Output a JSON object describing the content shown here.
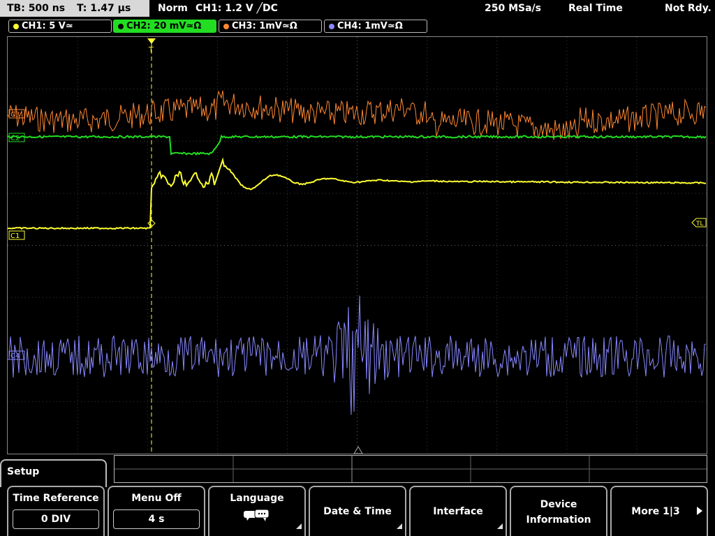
{
  "status": {
    "timebase": "TB: 500 ns",
    "trigger_time": "T: 1.47 µs",
    "trigger_mode": "Norm",
    "trigger_info": "CH1: 1.2 V ╱DC",
    "sample_rate": "250 MSa/s",
    "acq_mode": "Real Time",
    "state": "Not Rdy."
  },
  "channels": [
    {
      "label": "CH1: 5 V≃",
      "color": "#ffff33"
    },
    {
      "label": "CH2: 20 mV≃Ω",
      "color": "#22dd22"
    },
    {
      "label": "CH3: 1mV≃Ω",
      "color": "#ff8833"
    },
    {
      "label": "CH4: 1mV≃Ω",
      "color": "#8888ff"
    }
  ],
  "markers": {
    "c1": "C1",
    "c2": "C2",
    "c3": "C3",
    "c4": "C4",
    "tl": "TL",
    "trigger": "T"
  },
  "menu": {
    "title": "Setup",
    "softkeys": [
      {
        "label": "Time Reference",
        "value": "0 DIV"
      },
      {
        "label": "Menu Off",
        "value": "4 s"
      },
      {
        "label": "Language"
      },
      {
        "label": "Date & Time"
      },
      {
        "label": "Interface"
      },
      {
        "label": "Device",
        "label2": "Information"
      },
      {
        "label": "More 1|3"
      }
    ]
  },
  "colors": {
    "ch1": "#ffff33",
    "ch2": "#22dd22",
    "ch3": "#ff8833",
    "ch4": "#8888ff",
    "grid": "#555555"
  }
}
